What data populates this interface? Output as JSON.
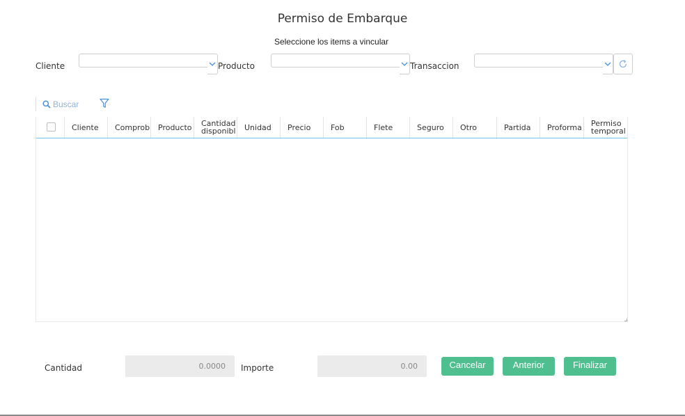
{
  "dialog": {
    "title": "Permiso de Embarque",
    "subtitle": "Seleccione los items a vincular"
  },
  "filters": {
    "cliente_label": "Cliente",
    "producto_label": "Producto",
    "transaccion_label": "Transaccion",
    "cliente_value": "",
    "producto_value": "",
    "transaccion_value": ""
  },
  "toolbar": {
    "search_label": "Buscar"
  },
  "grid": {
    "columns": [
      "Cliente",
      "Comprob",
      "Producto",
      "Cantidad disponibl",
      "Unidad",
      "Precio",
      "Fob",
      "Flete",
      "Seguro",
      "Otro",
      "Partida",
      "Proforma",
      "Permiso temporal"
    ],
    "rows": []
  },
  "totals": {
    "cantidad_label": "Cantidad",
    "cantidad_value": "0.0000",
    "importe_label": "Importe",
    "importe_value": "0.00"
  },
  "actions": {
    "cancel_label": "Cancelar",
    "back_label": "Anterior",
    "finish_label": "Finalizar"
  },
  "colors": {
    "accent_green": "#4fbf8f",
    "header_underline": "#6ec3e6",
    "link_blue": "#4a90d9"
  },
  "icons": [
    "search-icon",
    "filter-icon",
    "chevron-down-icon",
    "refresh-icon"
  ]
}
